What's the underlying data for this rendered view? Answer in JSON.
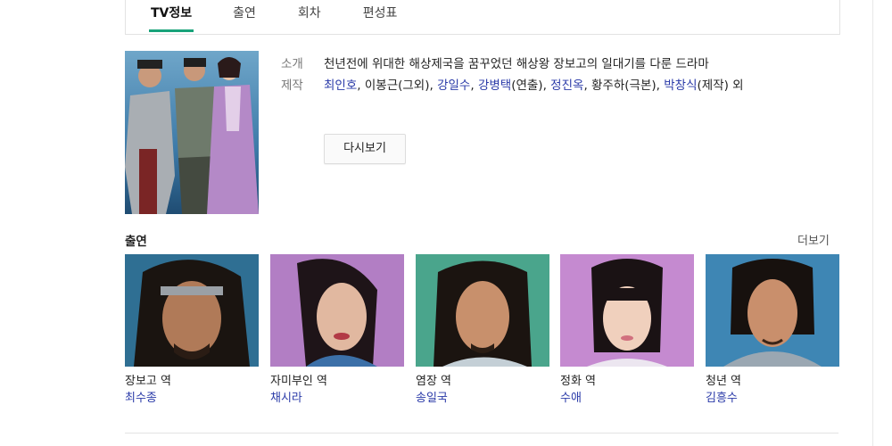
{
  "tabs": [
    {
      "label": "TV정보",
      "active": true
    },
    {
      "label": "출연",
      "active": false
    },
    {
      "label": "회차",
      "active": false
    },
    {
      "label": "편성표",
      "active": false
    }
  ],
  "info": {
    "intro_label": "소개",
    "intro_text": "천년전에 위대한 해상제국을 꿈꾸었던 해상왕 장보고의 일대기를 다룬 드라마",
    "staff_label": "제작",
    "staff": [
      {
        "text": "최인호",
        "link": true
      },
      {
        "text": ", 이봉근(그외), ",
        "link": false
      },
      {
        "text": "강일수",
        "link": true
      },
      {
        "text": ", ",
        "link": false
      },
      {
        "text": "강병택",
        "link": true
      },
      {
        "text": "(연출), ",
        "link": false
      },
      {
        "text": "정진옥",
        "link": true
      },
      {
        "text": ", 황주하(극본), ",
        "link": false
      },
      {
        "text": "박창식",
        "link": true
      },
      {
        "text": "(제작) 외",
        "link": false
      }
    ],
    "rewatch_label": "다시보기"
  },
  "cast": {
    "title": "출연",
    "more_label": "더보기",
    "members": [
      {
        "role": "장보고 역",
        "actor": "최수종"
      },
      {
        "role": "자미부인 역",
        "actor": "채시라"
      },
      {
        "role": "염장 역",
        "actor": "송일국"
      },
      {
        "role": "정화 역",
        "actor": "수애"
      },
      {
        "role": "청년 역",
        "actor": "김흥수"
      }
    ]
  },
  "colors": {
    "accent": "#19a37a",
    "link": "#2a3aa8"
  }
}
